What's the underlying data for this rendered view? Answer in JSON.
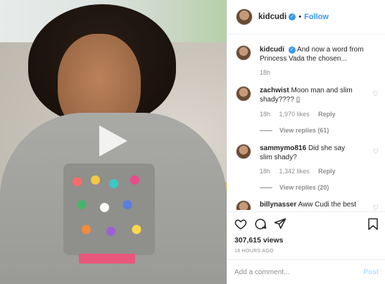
{
  "header": {
    "username": "kidcudi",
    "separator": "•",
    "follow_label": "Follow"
  },
  "caption": {
    "username": "kidcudi",
    "text": "And now a word from Princess Vada the chosen...",
    "time": "18h"
  },
  "comments": [
    {
      "username": "zachwist",
      "text": "Moon man and slim shady???? ▯",
      "time": "18h",
      "likes": "1,970 likes",
      "reply_label": "Reply",
      "view_replies": "View replies (61)"
    },
    {
      "username": "sammymo816",
      "text": "Did she say slim shady?",
      "time": "18h",
      "likes": "1,342 likes",
      "reply_label": "Reply",
      "view_replies": "View replies (20)"
    },
    {
      "username": "billynasser",
      "text": "Aww Cudi the best"
    }
  ],
  "stats": {
    "views": "307,615 views",
    "timestamp": "18 HOURS AGO"
  },
  "add_comment": {
    "placeholder": "Add a comment...",
    "post_label": "Post"
  },
  "icons": [
    "heart-icon",
    "comment-icon",
    "share-icon",
    "bookmark-icon",
    "play-icon",
    "verified-icon"
  ],
  "colors": {
    "accent": "#3897f0",
    "post_disabled": "#b2dffc",
    "muted": "#8e8e8e"
  }
}
